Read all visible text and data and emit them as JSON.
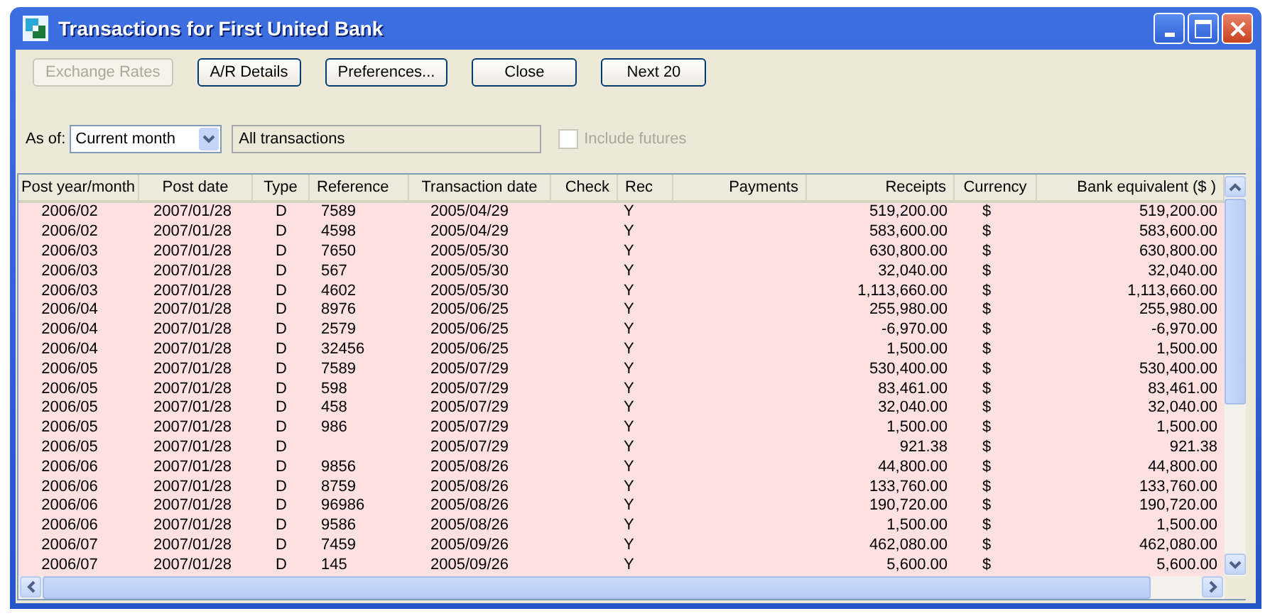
{
  "window": {
    "title": "Transactions for First United Bank"
  },
  "buttons": [
    {
      "label": "Exchange Rates",
      "disabled": true
    },
    {
      "label": "A/R Details",
      "disabled": false
    },
    {
      "label": "Preferences...",
      "disabled": false
    },
    {
      "label": "Close",
      "disabled": false
    },
    {
      "label": "Next  20",
      "disabled": false
    }
  ],
  "as_of": {
    "label": "As of:",
    "value": "Current month"
  },
  "filter_field": {
    "value": "All transactions",
    "disabled": true
  },
  "include_futures": {
    "label": "Include futures",
    "checked": false,
    "disabled": true
  },
  "table": {
    "columns": [
      "Post year/month",
      "Post date",
      "Type",
      "Reference",
      "Transaction date",
      "Check",
      "Rec",
      "Payments",
      "Receipts",
      "Currency",
      "Bank equivalent ($ )"
    ],
    "rows": [
      {
        "post_year_month": "2006/02",
        "post_date": "2007/01/28",
        "type": "D",
        "reference": "7589",
        "transaction_date": "2005/04/29",
        "rec": "Y",
        "receipts": "519,200.00",
        "currency": "$",
        "bank_equivalent": "519,200.00"
      },
      {
        "post_year_month": "2006/02",
        "post_date": "2007/01/28",
        "type": "D",
        "reference": "4598",
        "transaction_date": "2005/04/29",
        "rec": "Y",
        "receipts": "583,600.00",
        "currency": "$",
        "bank_equivalent": "583,600.00"
      },
      {
        "post_year_month": "2006/03",
        "post_date": "2007/01/28",
        "type": "D",
        "reference": "7650",
        "transaction_date": "2005/05/30",
        "rec": "Y",
        "receipts": "630,800.00",
        "currency": "$",
        "bank_equivalent": "630,800.00"
      },
      {
        "post_year_month": "2006/03",
        "post_date": "2007/01/28",
        "type": "D",
        "reference": "567",
        "transaction_date": "2005/05/30",
        "rec": "Y",
        "receipts": "32,040.00",
        "currency": "$",
        "bank_equivalent": "32,040.00"
      },
      {
        "post_year_month": "2006/03",
        "post_date": "2007/01/28",
        "type": "D",
        "reference": "4602",
        "transaction_date": "2005/05/30",
        "rec": "Y",
        "receipts": "1,113,660.00",
        "currency": "$",
        "bank_equivalent": "1,113,660.00"
      },
      {
        "post_year_month": "2006/04",
        "post_date": "2007/01/28",
        "type": "D",
        "reference": "8976",
        "transaction_date": "2005/06/25",
        "rec": "Y",
        "receipts": "255,980.00",
        "currency": "$",
        "bank_equivalent": "255,980.00"
      },
      {
        "post_year_month": "2006/04",
        "post_date": "2007/01/28",
        "type": "D",
        "reference": "2579",
        "transaction_date": "2005/06/25",
        "rec": "Y",
        "receipts": "-6,970.00",
        "currency": "$",
        "bank_equivalent": "-6,970.00"
      },
      {
        "post_year_month": "2006/04",
        "post_date": "2007/01/28",
        "type": "D",
        "reference": "32456",
        "transaction_date": "2005/06/25",
        "rec": "Y",
        "receipts": "1,500.00",
        "currency": "$",
        "bank_equivalent": "1,500.00"
      },
      {
        "post_year_month": "2006/05",
        "post_date": "2007/01/28",
        "type": "D",
        "reference": "7589",
        "transaction_date": "2005/07/29",
        "rec": "Y",
        "receipts": "530,400.00",
        "currency": "$",
        "bank_equivalent": "530,400.00"
      },
      {
        "post_year_month": "2006/05",
        "post_date": "2007/01/28",
        "type": "D",
        "reference": "598",
        "transaction_date": "2005/07/29",
        "rec": "Y",
        "receipts": "83,461.00",
        "currency": "$",
        "bank_equivalent": "83,461.00"
      },
      {
        "post_year_month": "2006/05",
        "post_date": "2007/01/28",
        "type": "D",
        "reference": "458",
        "transaction_date": "2005/07/29",
        "rec": "Y",
        "receipts": "32,040.00",
        "currency": "$",
        "bank_equivalent": "32,040.00"
      },
      {
        "post_year_month": "2006/05",
        "post_date": "2007/01/28",
        "type": "D",
        "reference": "986",
        "transaction_date": "2005/07/29",
        "rec": "Y",
        "receipts": "1,500.00",
        "currency": "$",
        "bank_equivalent": "1,500.00"
      },
      {
        "post_year_month": "2006/05",
        "post_date": "2007/01/28",
        "type": "D",
        "transaction_date": "2005/07/29",
        "rec": "Y",
        "receipts": "921.38",
        "currency": "$",
        "bank_equivalent": "921.38"
      },
      {
        "post_year_month": "2006/06",
        "post_date": "2007/01/28",
        "type": "D",
        "reference": "9856",
        "transaction_date": "2005/08/26",
        "rec": "Y",
        "receipts": "44,800.00",
        "currency": "$",
        "bank_equivalent": "44,800.00"
      },
      {
        "post_year_month": "2006/06",
        "post_date": "2007/01/28",
        "type": "D",
        "reference": "8759",
        "transaction_date": "2005/08/26",
        "rec": "Y",
        "receipts": "133,760.00",
        "currency": "$",
        "bank_equivalent": "133,760.00"
      },
      {
        "post_year_month": "2006/06",
        "post_date": "2007/01/28",
        "type": "D",
        "reference": "96986",
        "transaction_date": "2005/08/26",
        "rec": "Y",
        "receipts": "190,720.00",
        "currency": "$",
        "bank_equivalent": "190,720.00"
      },
      {
        "post_year_month": "2006/06",
        "post_date": "2007/01/28",
        "type": "D",
        "reference": "9586",
        "transaction_date": "2005/08/26",
        "rec": "Y",
        "receipts": "1,500.00",
        "currency": "$",
        "bank_equivalent": "1,500.00"
      },
      {
        "post_year_month": "2006/07",
        "post_date": "2007/01/28",
        "type": "D",
        "reference": "7459",
        "transaction_date": "2005/09/26",
        "rec": "Y",
        "receipts": "462,080.00",
        "currency": "$",
        "bank_equivalent": "462,080.00"
      },
      {
        "post_year_month": "2006/07",
        "post_date": "2007/01/28",
        "type": "D",
        "reference": "145",
        "transaction_date": "2005/09/26",
        "rec": "Y",
        "receipts": "5,600.00",
        "currency": "$",
        "bank_equivalent": "5,600.00"
      }
    ]
  }
}
